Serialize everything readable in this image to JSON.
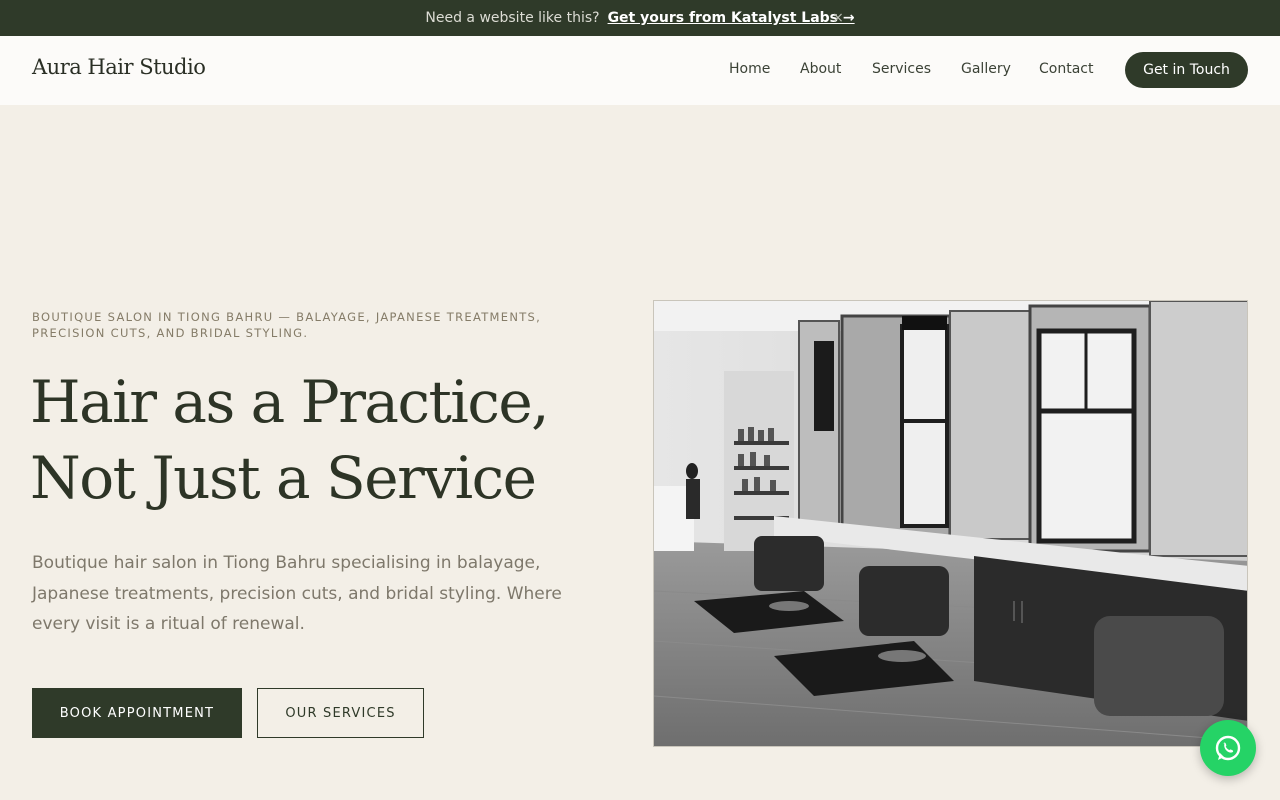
{
  "promo": {
    "text": "Need a website like this?",
    "link": "Get yours from Katalyst Labs →",
    "close": "×"
  },
  "nav": {
    "logo": "Aura Hair Studio",
    "items": [
      {
        "label": "Home"
      },
      {
        "label": "About"
      },
      {
        "label": "Services"
      },
      {
        "label": "Gallery"
      },
      {
        "label": "Contact"
      }
    ],
    "cta": "Get in Touch"
  },
  "hero": {
    "eyebrow": "BOUTIQUE SALON IN TIONG BAHRU — BALAYAGE, JAPANESE TREATMENTS, PRECISION CUTS, AND BRIDAL STYLING.",
    "headline_line1": "Hair as a Practice,",
    "headline_line2": "Not Just a Service",
    "subtext": "Boutique hair salon in Tiong Bahru specialising in balayage, Japanese treatments, precision cuts, and bridal styling. Where every visit is a ritual of renewal.",
    "primary_button": "BOOK APPOINTMENT",
    "secondary_button": "OUR SERVICES"
  },
  "colors": {
    "brand_dark": "#2f3a29",
    "background": "#f3efe7",
    "whatsapp": "#25d366"
  },
  "icons": {
    "close": "close-icon",
    "floating": "whatsapp-icon"
  }
}
